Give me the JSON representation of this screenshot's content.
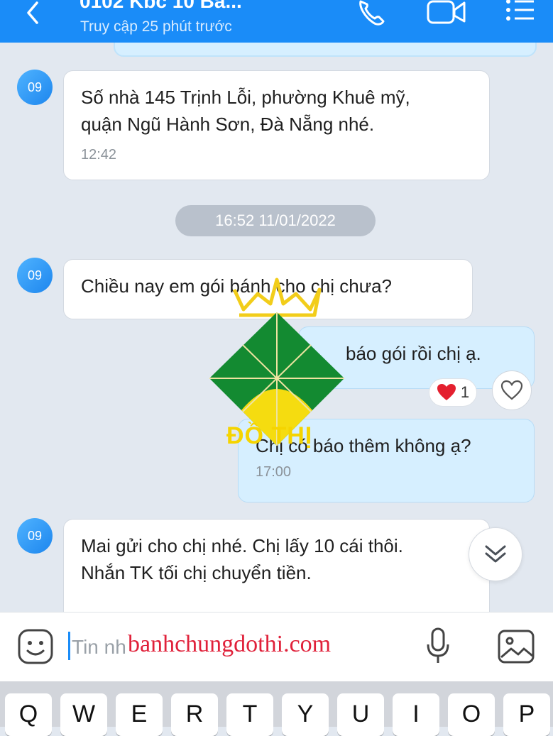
{
  "header": {
    "title": "0102 Kbc 10 Ba...",
    "subtitle": "Truy cập 25 phút trước",
    "color": "#1a8cf8"
  },
  "messages": [
    {
      "avatar": "09",
      "lines": [
        "Số nhà 145 Trịnh Lỗi, phường Khuê mỹ,",
        "quận Ngũ Hành Sơn, Đà Nẵng nhé."
      ],
      "time": "12:42"
    },
    {
      "avatar": "09",
      "lines": [
        "Chiều nay em gói bánh cho chị chưa?"
      ]
    },
    {
      "lines": [
        "báo gói rồi chị ạ."
      ]
    },
    {
      "lines": [
        "Chị có báo thêm không ạ?"
      ],
      "time": "17:00"
    },
    {
      "avatar": "09",
      "lines": [
        "Mai gửi cho chị nhé. Chị lấy 10 cái thôi.",
        "Nhắn TK tối chị chuyển tiền."
      ]
    }
  ],
  "date_separator": "16:52 11/01/2022",
  "reaction": {
    "icon": "heart-icon",
    "count": "1"
  },
  "logo": {
    "text": "ĐỒ THỊ"
  },
  "input": {
    "placeholder": "Tin nh",
    "watermark": "banhchungdothi.com"
  },
  "keyboard": {
    "keys": [
      "Q",
      "W",
      "E",
      "R",
      "T",
      "Y",
      "U",
      "I",
      "O",
      "P"
    ]
  },
  "icons": [
    "back-icon",
    "phone-icon",
    "video-call-icon",
    "menu-icon",
    "heart-icon",
    "like-heart-icon",
    "chevron-double-down-icon",
    "sticker-icon",
    "microphone-icon",
    "image-icon"
  ]
}
